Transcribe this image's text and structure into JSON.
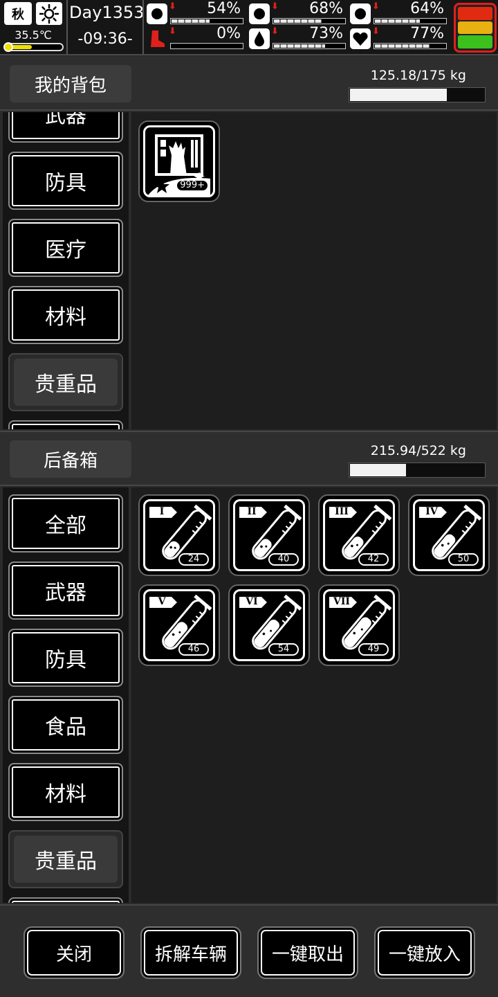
{
  "status": {
    "season": "秋",
    "weather_icon": "sun-icon",
    "temperature": "35.5℃",
    "temperature_level": 0.45,
    "day": "Day1353",
    "time": "-09:36-",
    "stats": [
      {
        "icon": "medkit-icon",
        "value": "54%",
        "fraction": 0.54,
        "trend": "down"
      },
      {
        "icon": "stomach-icon",
        "value": "68%",
        "fraction": 0.68,
        "trend": "down"
      },
      {
        "icon": "pill-icon",
        "value": "64%",
        "fraction": 0.64,
        "trend": "down"
      },
      {
        "icon": "boot-icon",
        "value": "0%",
        "fraction": 0.0,
        "trend": "down"
      },
      {
        "icon": "water-drop-icon",
        "value": "73%",
        "fraction": 0.73,
        "trend": "down"
      },
      {
        "icon": "heart-icon",
        "value": "77%",
        "fraction": 0.77,
        "trend": "down"
      }
    ],
    "traffic_light": {
      "colors": [
        "#e02a12",
        "#e8b010",
        "#3cc11c"
      ]
    }
  },
  "backpack": {
    "title": "我的背包",
    "weight": "125.18/175 kg",
    "fill": 0.715,
    "categories": [
      "武器",
      "防具",
      "医疗",
      "材料",
      "贵重品"
    ],
    "active_category": "贵重品",
    "items": [
      {
        "icon": "zombie-hand-card-icon",
        "qty": "999+"
      }
    ]
  },
  "trunk": {
    "title": "后备箱",
    "weight": "215.94/522 kg",
    "fill": 0.413,
    "categories": [
      "全部",
      "武器",
      "防具",
      "食品",
      "材料",
      "贵重品"
    ],
    "active_category": "贵重品",
    "items": [
      {
        "icon": "test-tube-icon",
        "tier": "I",
        "qty": "24",
        "level": 0.28
      },
      {
        "icon": "test-tube-icon",
        "tier": "II",
        "qty": "40",
        "level": 0.38
      },
      {
        "icon": "test-tube-icon",
        "tier": "III",
        "qty": "42",
        "level": 0.48
      },
      {
        "icon": "test-tube-icon",
        "tier": "IV",
        "qty": "50",
        "level": 0.58
      },
      {
        "icon": "test-tube-icon",
        "tier": "V",
        "qty": "46",
        "level": 0.68
      },
      {
        "icon": "test-tube-icon",
        "tier": "VI",
        "qty": "54",
        "level": 0.78
      },
      {
        "icon": "test-tube-icon",
        "tier": "VII",
        "qty": "49",
        "level": 0.88
      }
    ]
  },
  "footer": {
    "buttons": [
      "关闭",
      "拆解车辆",
      "一键取出",
      "一键放入"
    ]
  }
}
